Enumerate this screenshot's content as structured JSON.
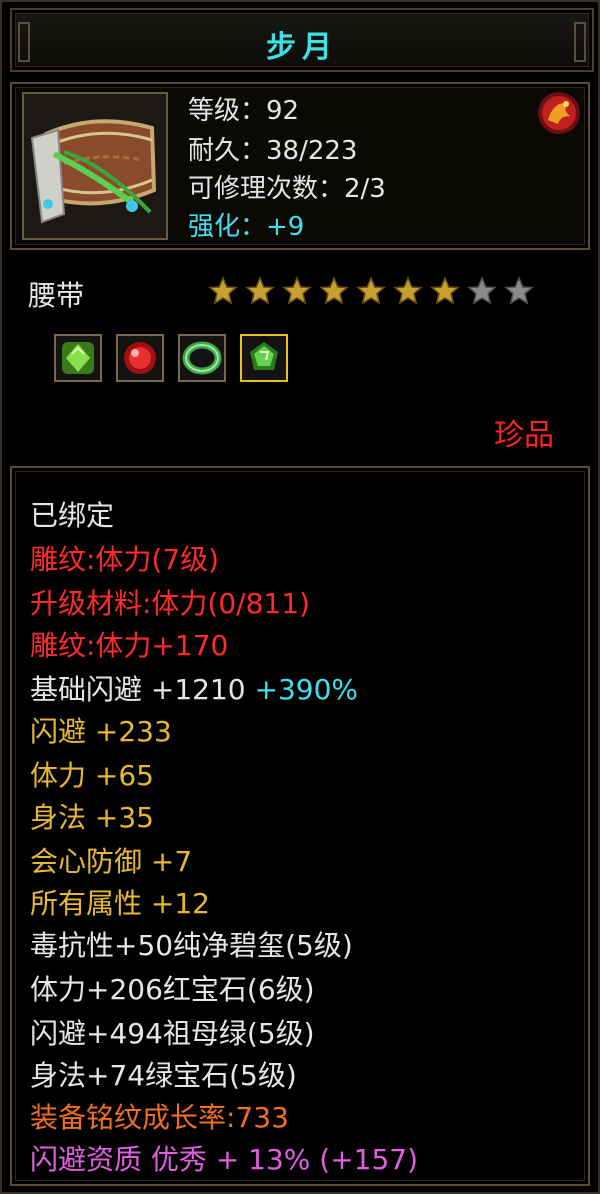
{
  "title": "步月",
  "header": {
    "level": "等级：92",
    "durability": "耐久：38/223",
    "repairs": "可修理次数：2/3",
    "enhance": "强化：+9"
  },
  "item": {
    "name": "腰带",
    "stars_filled": 7,
    "stars_total": 9,
    "rarity": "珍品",
    "gems": [
      {
        "icon": "green-gem-icon",
        "color": "#6fd23a"
      },
      {
        "icon": "red-gem-icon",
        "color": "#e02828"
      },
      {
        "icon": "jade-ring-icon",
        "color": "#3fa84a"
      },
      {
        "icon": "emerald-gem-icon",
        "color": "#58c840"
      }
    ]
  },
  "details": {
    "bound": "已绑定",
    "carve1": "雕纹:体力(7级)",
    "upgrade": "升级材料:体力(0/811)",
    "carve2": "雕纹:体力+170",
    "base_dodge": "基础闪避 +1210",
    "base_dodge_pct": "+390%",
    "dodge": "闪避 +233",
    "stamina": "体力 +65",
    "agility": "身法 +35",
    "crit_def": "会心防御 +7",
    "all_attr": "所有属性 +12",
    "gem1": "毒抗性+50纯净碧玺(5级)",
    "gem2": "体力+206红宝石(6级)",
    "gem3": "闪避+494祖母绿(5级)",
    "gem4": "身法+74绿宝石(5级)",
    "growth": "装备铭纹成长率:733",
    "quality": "闪避资质 优秀 + 13% (+157)"
  },
  "colors": {
    "title": "#3fe0e6",
    "red": "#ff2a2a",
    "gold": "#e8b830",
    "orange": "#f07020",
    "pink": "#e060e0",
    "cyan": "#40e0f0"
  }
}
